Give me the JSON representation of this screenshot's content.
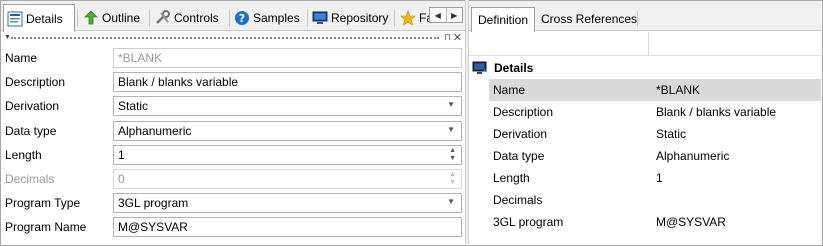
{
  "left_tabs": [
    {
      "label": "Details",
      "icon": "details-icon",
      "active": true
    },
    {
      "label": "Outline",
      "icon": "outline-icon",
      "active": false
    },
    {
      "label": "Controls",
      "icon": "controls-icon",
      "active": false
    },
    {
      "label": "Samples",
      "icon": "help-icon",
      "active": false
    },
    {
      "label": "Repository",
      "icon": "monitor-icon",
      "active": false
    },
    {
      "label": "Fa",
      "icon": "star-icon",
      "active": false
    }
  ],
  "tab_scroll": {
    "left_glyph": "◀",
    "right_glyph": "▶"
  },
  "form": {
    "name": {
      "label": "Name",
      "value": "*BLANK"
    },
    "description": {
      "label": "Description",
      "value": "Blank / blanks variable"
    },
    "derivation": {
      "label": "Derivation",
      "value": "Static"
    },
    "data_type": {
      "label": "Data type",
      "value": "Alphanumeric"
    },
    "length": {
      "label": "Length",
      "value": "1"
    },
    "decimals": {
      "label": "Decimals",
      "value": "0"
    },
    "program_type": {
      "label": "Program Type",
      "value": "3GL program"
    },
    "program_name": {
      "label": "Program Name",
      "value": "M@SYSVAR"
    }
  },
  "right_tabs": [
    {
      "label": "Definition",
      "active": true
    },
    {
      "label": "Cross References",
      "active": false
    }
  ],
  "details_group": {
    "title": "Details",
    "rows": [
      {
        "key": "Name",
        "value": "*BLANK"
      },
      {
        "key": "Description",
        "value": "Blank / blanks variable"
      },
      {
        "key": "Derivation",
        "value": "Static"
      },
      {
        "key": "Data type",
        "value": "Alphanumeric"
      },
      {
        "key": "Length",
        "value": "1"
      },
      {
        "key": "Decimals",
        "value": ""
      },
      {
        "key": "3GL program",
        "value": "M@SYSVAR"
      }
    ]
  },
  "colors": {
    "selected_row": "#d9d9d9",
    "tab_bg": "#f0f0f0",
    "border": "#b4b4b4"
  }
}
